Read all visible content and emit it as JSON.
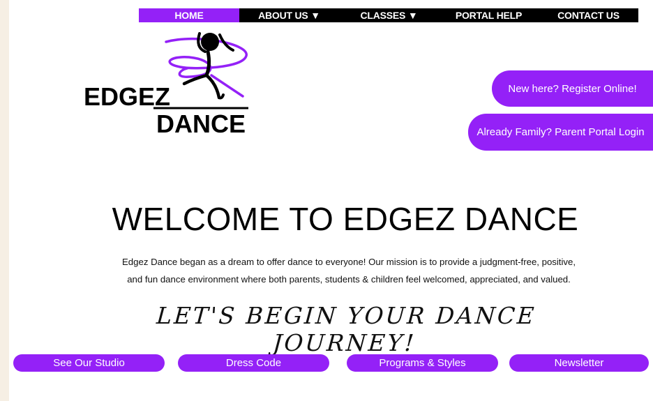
{
  "nav": {
    "items": [
      {
        "label": "HOME"
      },
      {
        "label": "ABOUT US ▼"
      },
      {
        "label": "CLASSES ▼"
      },
      {
        "label": "PORTAL HELP"
      },
      {
        "label": "CONTACT US"
      }
    ]
  },
  "logo": {
    "line1": "EDGEZ",
    "line2": "DANCE"
  },
  "cta": {
    "register": "New here? Register Online!",
    "portal": "Already Family? Parent Portal Login"
  },
  "welcome": {
    "title": "WELCOME TO EDGEZ DANCE",
    "line1": "Edgez Dance began as a dream to offer dance to everyone! Our mission is to provide a judgment-free, positive,",
    "line2": "and fun dance environment where both parents, students & children feel welcomed, appreciated, and valued.",
    "journey": "LET'S BEGIN YOUR DANCE JOURNEY!"
  },
  "buttons": [
    {
      "label": "See Our Studio"
    },
    {
      "label": "Dress Code"
    },
    {
      "label": "Programs & Styles"
    },
    {
      "label": "Newsletter"
    }
  ],
  "colors": {
    "accent": "#9421f7",
    "nav_bg": "#000000",
    "page_border": "#f6efe4"
  }
}
